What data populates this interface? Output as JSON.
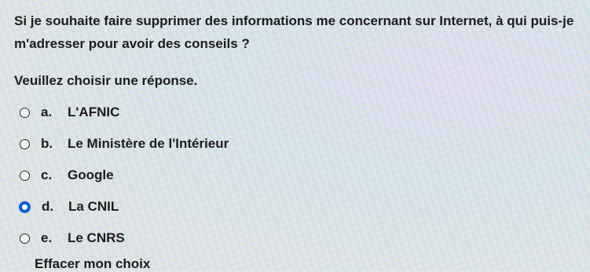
{
  "question": {
    "text": "Si je souhaite faire supprimer des informations me concernant sur Internet, à qui puis-je m'adresser pour avoir des conseils ?"
  },
  "instruction": "Veuillez choisir une réponse.",
  "options": [
    {
      "letter": "a.",
      "label": "L'AFNIC",
      "selected": false
    },
    {
      "letter": "b.",
      "label": "Le Ministère de l'Intérieur",
      "selected": false
    },
    {
      "letter": "c.",
      "label": "Google",
      "selected": false
    },
    {
      "letter": "d.",
      "label": "La CNIL",
      "selected": true
    },
    {
      "letter": "e.",
      "label": "Le CNRS",
      "selected": false
    }
  ],
  "clear_choice": "Effacer mon choix",
  "colors": {
    "selected_radio": "#0a5fd6",
    "text": "#1c1c1e"
  }
}
